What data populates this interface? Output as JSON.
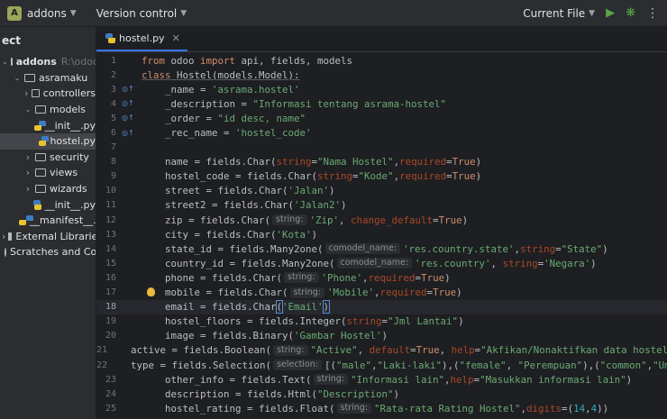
{
  "topbar": {
    "project_badge": "A",
    "project_name": "addons",
    "vcs_label": "Version control",
    "run_config": "Current File"
  },
  "project_panel": {
    "header": "ect",
    "tree": [
      {
        "label": "addons",
        "hint": "R:\\odooku\\ad",
        "kind": "folder",
        "depth": 0,
        "expanded": true
      },
      {
        "label": "asramaku",
        "kind": "folder",
        "depth": 1,
        "expanded": true
      },
      {
        "label": "controllers",
        "kind": "folder",
        "depth": 2,
        "expanded": false
      },
      {
        "label": "models",
        "kind": "folder",
        "depth": 2,
        "expanded": true
      },
      {
        "label": "__init__.py",
        "kind": "py",
        "depth": 3
      },
      {
        "label": "hostel.py",
        "kind": "py",
        "depth": 3,
        "selected": true
      },
      {
        "label": "security",
        "kind": "folder",
        "depth": 2,
        "expanded": false
      },
      {
        "label": "views",
        "kind": "folder",
        "depth": 2,
        "expanded": false
      },
      {
        "label": "wizards",
        "kind": "folder",
        "depth": 2,
        "expanded": false
      },
      {
        "label": "__init__.py",
        "kind": "py",
        "depth": 2
      },
      {
        "label": "__manifest__.py",
        "kind": "py",
        "depth": 2
      },
      {
        "label": "External Libraries",
        "kind": "lib",
        "depth": 0,
        "expanded": false
      },
      {
        "label": "Scratches and Consoles",
        "kind": "scratch",
        "depth": 0
      }
    ]
  },
  "editor": {
    "tab_label": "hostel.py",
    "current_line": 18,
    "line_numbers": [
      "1",
      "2",
      "3",
      "4",
      "5",
      "6",
      "7",
      "8",
      "9",
      "10",
      "11",
      "12",
      "13",
      "14",
      "15",
      "16",
      "17",
      "18",
      "19",
      "20",
      "21",
      "22",
      "23",
      "24",
      "25"
    ],
    "hints": {
      "string": "string:",
      "comodel": "comodel_name:",
      "selection": "selection:"
    },
    "code": {
      "l1": [
        "from",
        " odoo ",
        "import",
        " api, fields, models"
      ],
      "l2": [
        "class",
        " Hostel(models.Model):"
      ],
      "l3": [
        "    _name = ",
        "'asrama.hostel'"
      ],
      "l4": [
        "    _description = ",
        "\"Informasi tentang asrama-hostel\""
      ],
      "l5": [
        "    _order = ",
        "\"id desc, name\""
      ],
      "l6": [
        "    _rec_name = ",
        "'hostel_code'"
      ],
      "l8": [
        "    name = fields.Char(",
        "string",
        "=",
        "\"Nama Hostel\"",
        ",",
        "required",
        "=",
        "True",
        ")"
      ],
      "l9": [
        "    hostel_code = fields.Char(",
        "string",
        "=",
        "\"Kode\"",
        ",",
        "required",
        "=",
        "True",
        ")"
      ],
      "l10": [
        "    street = fields.Char(",
        "'Jalan'",
        ")"
      ],
      "l11": [
        "    street2 = fields.Char(",
        "'Jalan2'",
        ")"
      ],
      "l12": [
        "    zip = fields.Char(",
        "'Zip'",
        ", ",
        "change_default",
        "=",
        "True",
        ")"
      ],
      "l13": [
        "    city = fields.Char(",
        "'Kota'",
        ")"
      ],
      "l14": [
        "    state_id = fields.Many2one(",
        "'res.country.state'",
        ",",
        "string",
        "=",
        "\"State\"",
        ")"
      ],
      "l15": [
        "    country_id = fields.Many2one(",
        "'res.country'",
        ", ",
        "string",
        "=",
        "'Negara'",
        ")"
      ],
      "l16": [
        "    phone = fields.Char(",
        "'Phone'",
        ",",
        "required",
        "=",
        "True",
        ")"
      ],
      "l17": [
        "    mobile = fields.Char(",
        "'Mobile'",
        ",",
        "required",
        "=",
        "True",
        ")"
      ],
      "l18": [
        "    email = fields.Char",
        "(",
        "'Email'",
        ")"
      ],
      "l19": [
        "    hostel_floors = fields.Integer(",
        "string",
        "=",
        "\"Jml Lantai\"",
        ")"
      ],
      "l20": [
        "    image = fields.Binary(",
        "'Gambar Hostel'",
        ")"
      ],
      "l21": [
        "    active = fields.Boolean(",
        "\"Active\"",
        ", ",
        "default",
        "=",
        "True",
        ", ",
        "help",
        "=",
        "\"Akfikan/Nonaktifkan data hostel\"",
        ")"
      ],
      "l22": [
        "    type = fields.Selection(",
        "[(",
        "\"male\"",
        ",",
        "\"Laki-laki\"",
        "),(",
        "\"female\"",
        ", ",
        "\"Perempuan\"",
        "),(",
        "\"common\"",
        ",",
        "\"Umum\"",
        ")]"
      ],
      "l23": [
        "    other_info = fields.Text(",
        "\"Informasi lain\"",
        ",",
        "help",
        "=",
        "\"Masukkan informasi lain\"",
        ")"
      ],
      "l24": [
        "    description = fields.Html(",
        "\"Description\"",
        ")"
      ],
      "l25": [
        "    hostel_rating = fields.Float(",
        "\"Rata-rata Rating Hostel\"",
        ",",
        "digits",
        "=",
        "(",
        "14",
        ",",
        "4",
        "))"
      ]
    }
  }
}
